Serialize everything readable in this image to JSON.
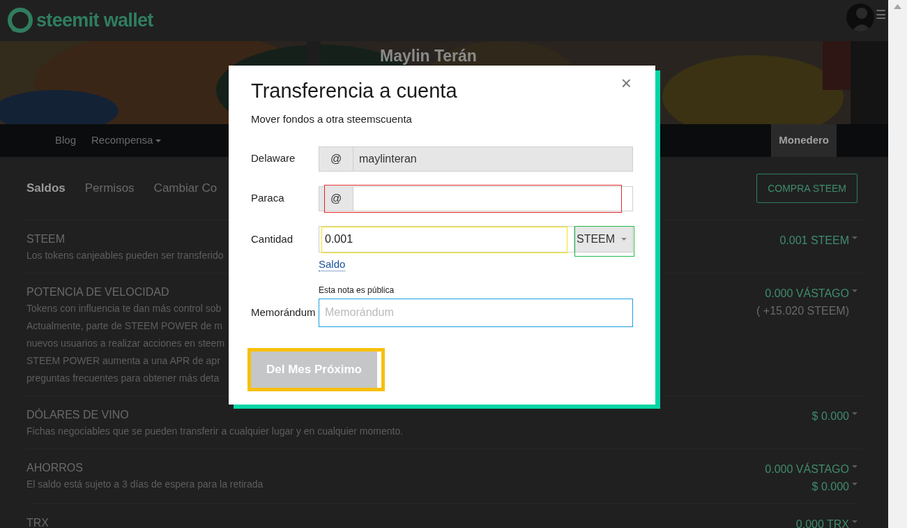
{
  "header": {
    "logo": "steemit wallet",
    "menu_icon": "☰"
  },
  "banner": {
    "kind": "picture",
    "name": "Maylin Terán"
  },
  "nav": [
    {
      "label": "Blog",
      "selected": false,
      "dropdown": false
    },
    {
      "label": "Recompensa",
      "selected": false,
      "dropdown": true
    },
    {
      "label": "Monedero",
      "selected": true,
      "dropdown": false
    }
  ],
  "subtabs": [
    {
      "label": "Saldos",
      "selected": true
    },
    {
      "label": "Permisos",
      "selected": false
    },
    {
      "label": "Cambiar Co",
      "selected": false
    }
  ],
  "buy_button": "COMPRA STEEM",
  "balances": [
    {
      "title": "STEEM",
      "description": [
        "Los tokens canjeables pueden ser transferido"
      ],
      "amounts": [
        {
          "text": "0.001 STEEM",
          "dropdown": true
        }
      ]
    },
    {
      "title": "POTENCIA DE VELOCIDAD",
      "description": [
        "Tokens con influencia te dan más control sob",
        "Actualmente, parte de STEEM POWER de m",
        "nuevos usuarios a realizar acciones en steem",
        "STEEM POWER aumenta a una APR de apr",
        "preguntas frecuentes para obtener más deta"
      ],
      "amounts": [
        {
          "text": "0.000 VÁSTAGO",
          "dropdown": true
        },
        {
          "text": "( +15.020 STEEM)",
          "dropdown": false
        }
      ]
    },
    {
      "title": "DÓLARES DE VINO",
      "description": [
        "Fichas negociables que se pueden transferir a cualquier lugar y en cualquier momento."
      ],
      "amounts": [
        {
          "text": "$ 0.000",
          "dropdown": true
        }
      ]
    },
    {
      "title": "AHORROS",
      "description": [
        "El saldo está sujeto a 3 días de espera para la retirada"
      ],
      "amounts": [
        {
          "text": "0.000 VÁSTAGO",
          "dropdown": true
        },
        {
          "text": "$ 0.000",
          "dropdown": true
        }
      ]
    },
    {
      "title": "TRX",
      "amounts": [
        {
          "text": "0.000 TRX",
          "dropdown": true
        }
      ]
    }
  ],
  "modal": {
    "title": "Transferencia a cuenta",
    "subtitle": "Mover fondos a otra steemscuenta",
    "close": "×",
    "fields": [
      {
        "kind": "account",
        "label": "Delaware",
        "prefix": "@",
        "value": "maylinteran",
        "disabled": true
      },
      {
        "kind": "account",
        "label": "Paraca",
        "prefix": "@",
        "disabled": false,
        "color": "#e02424"
      },
      {
        "kind": "amount",
        "label": "Cantidad",
        "value": "0.001",
        "unit": {
          "label": "STEEM",
          "color": "#1fb94a"
        },
        "link": "Saldo",
        "color": "#f5e616"
      },
      {
        "kind": "memo",
        "label": "Memorándum",
        "note": "Esta nota es pública",
        "placeholder": "Memorándum",
        "color": "#1a9ee6"
      }
    ],
    "submit": {
      "label": "Del Mes Próximo",
      "disabled": true,
      "color": "#f7c00a"
    }
  }
}
